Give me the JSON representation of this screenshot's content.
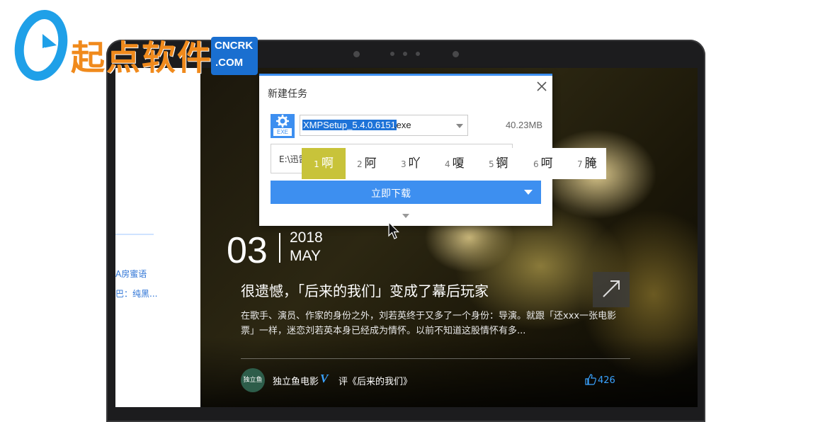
{
  "logo": {
    "brand": "起点软件",
    "badge_top": "CNCRK",
    "badge_bottom": ".COM"
  },
  "sidebar": {
    "link_1": "A房蜜语",
    "link_2": "巴：纯黑..."
  },
  "article": {
    "day": "03",
    "year": "2018",
    "month": "MAY",
    "headline": "很遗憾，「后来的我们」变成了幕后玩家",
    "summary": "在歌手、演员、作家的身份之外，刘若英终于又多了一个身份：导演。就跟「还xxx一张电影票」一样，迷恋刘若英本身已经成为情怀。以前不知道这股情怀有多...",
    "avatar_text": "独立鱼",
    "author": "独立鱼电影",
    "verified_mark": "V",
    "review": "评《后来的我们》",
    "likes": "426"
  },
  "dialog": {
    "title": "新建任务",
    "file_ext": "EXE",
    "filename_selected": "XMPSetup_5.4.0.6151",
    "filename_rest": ".exe",
    "filesize": "40.23MB",
    "path": "E:\\迅雷",
    "download_label": "立即下载"
  },
  "ime": {
    "candidates": [
      {
        "num": "1",
        "word": "啊"
      },
      {
        "num": "2",
        "word": "阿"
      },
      {
        "num": "3",
        "word": "吖"
      },
      {
        "num": "4",
        "word": "嗄"
      },
      {
        "num": "5",
        "word": "锕"
      },
      {
        "num": "6",
        "word": "呵"
      },
      {
        "num": "7",
        "word": "腌"
      }
    ]
  },
  "colors": {
    "accent": "#3d8ff0",
    "brand_orange": "#f08a1c",
    "ime_highlight": "#c8c33a"
  }
}
